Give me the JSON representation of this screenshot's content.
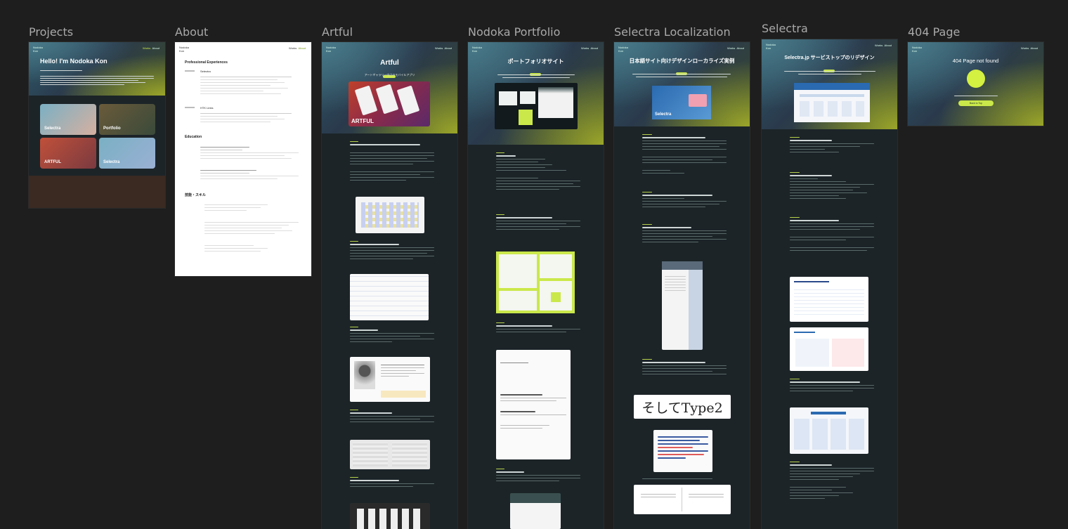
{
  "frames": [
    {
      "label": "Projects"
    },
    {
      "label": "About"
    },
    {
      "label": "Artful"
    },
    {
      "label": "Nodoka Portfolio"
    },
    {
      "label": "Selectra Localization"
    },
    {
      "label": "Selectra"
    },
    {
      "label": "404 Page"
    }
  ],
  "nav": {
    "brand_line1": "Nodoka",
    "brand_line2": "Kon",
    "link1": "Works",
    "link2": "About"
  },
  "projects": {
    "hero_title": "Hello! I'm Nodoka Kon",
    "cards": [
      "Selectra",
      "Portfolio",
      "ARTFUL",
      "Selectra"
    ]
  },
  "about": {
    "section_experience": "Professional Experiences",
    "section_education": "Education",
    "section_skills": "技能・スキル",
    "company1": "Selectra",
    "company2": "HTK Links"
  },
  "artful": {
    "title": "Artful",
    "subtitle": "アートギャラリー向けのモバイルアプリ",
    "banner": "ARTFUL"
  },
  "portfolio": {
    "title": "ポートフォリオサイト"
  },
  "localization": {
    "title": "日本語サイト向けデザインローカライズ実例",
    "brand": "Selectra",
    "sample_text": "そしてType2"
  },
  "selectra": {
    "title": "Selectra.jp サービストップのリデザイン"
  },
  "notfound": {
    "title": "404 Page not found",
    "button": "Back to Top"
  },
  "colors": {
    "background": "#1e1e1e",
    "frame_dark": "#1c2428",
    "accent": "#cbe84a"
  }
}
